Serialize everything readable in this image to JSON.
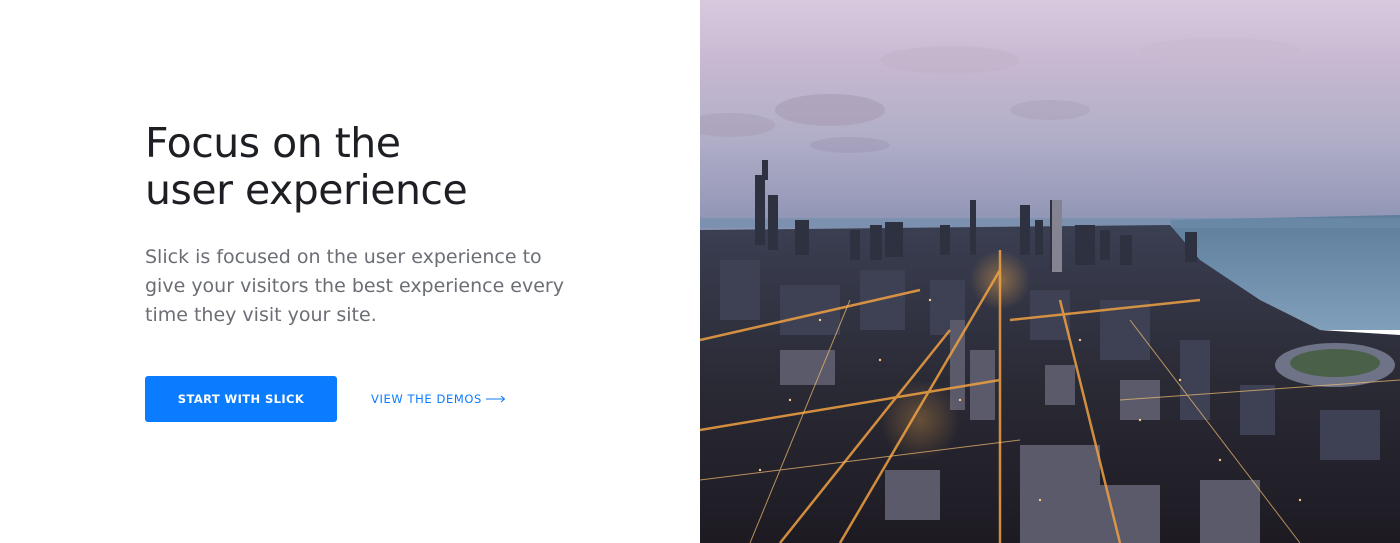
{
  "hero": {
    "headline_line1": "Focus on the",
    "headline_line2": "user experience",
    "lead": "Slick is focused on the user experience to give your visitors the best experience every time they visit your site.",
    "primary_button": "START WITH SLICK",
    "secondary_link": "VIEW THE DEMOS",
    "secondary_link_icon": "long-arrow-right-icon",
    "image_description_icon": "city-skyline-photo"
  },
  "colors": {
    "accent": "#0a7cff",
    "headline": "#1d1f24",
    "body_text": "#6b6e75"
  }
}
